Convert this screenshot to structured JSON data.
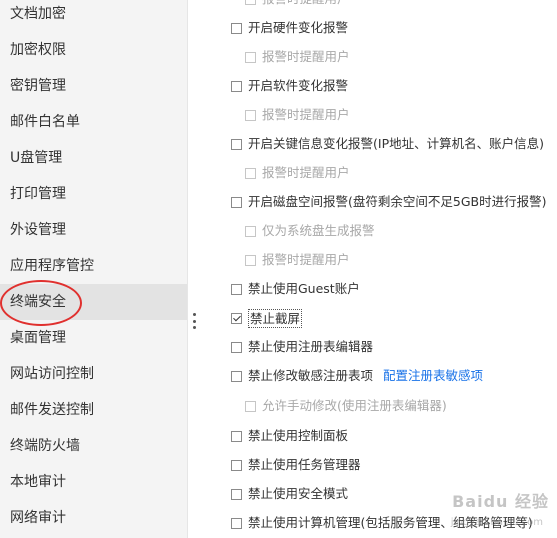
{
  "sidebar": {
    "items": [
      {
        "label": "文档加密"
      },
      {
        "label": "加密权限"
      },
      {
        "label": "密钥管理"
      },
      {
        "label": "邮件白名单"
      },
      {
        "label": "U盘管理"
      },
      {
        "label": "打印管理"
      },
      {
        "label": "外设管理"
      },
      {
        "label": "应用程序管控"
      },
      {
        "label": "终端安全",
        "active": true
      },
      {
        "label": "桌面管理"
      },
      {
        "label": "网站访问控制"
      },
      {
        "label": "邮件发送控制"
      },
      {
        "label": "终端防火墙"
      },
      {
        "label": "本地审计"
      },
      {
        "label": "网络审计"
      }
    ]
  },
  "settings": {
    "top_partial": "报警时提醒用户",
    "hardware_alarm": "开启硬件变化报警",
    "hardware_notify": "报警时提醒用户",
    "software_alarm": "开启软件变化报警",
    "software_notify": "报警时提醒用户",
    "key_info_alarm": "开启关键信息变化报警(IP地址、计算机名、账户信息)",
    "key_info_notify": "报警时提醒用户",
    "disk_alarm": "开启磁盘空间报警(盘符剩余空间不足5GB时进行报警)",
    "disk_system_only": "仅为系统盘生成报警",
    "disk_notify": "报警时提醒用户",
    "disable_guest": "禁止使用Guest账户",
    "disable_screenshot": "禁止截屏",
    "disable_regedit": "禁止使用注册表编辑器",
    "disable_modify_registry": "禁止修改敏感注册表项",
    "configure_registry_link": "配置注册表敏感项",
    "allow_manual_modify": "允许手动修改(使用注册表编辑器)",
    "disable_control_panel": "禁止使用控制面板",
    "disable_task_manager": "禁止使用任务管理器",
    "disable_safe_mode": "禁止使用安全模式",
    "disable_computer_mgmt": "禁止使用计算机管理(包括服务管理、组策略管理等)"
  },
  "watermark": {
    "text": "Baidu 经验",
    "sub": "jingyan.baidu.com"
  }
}
